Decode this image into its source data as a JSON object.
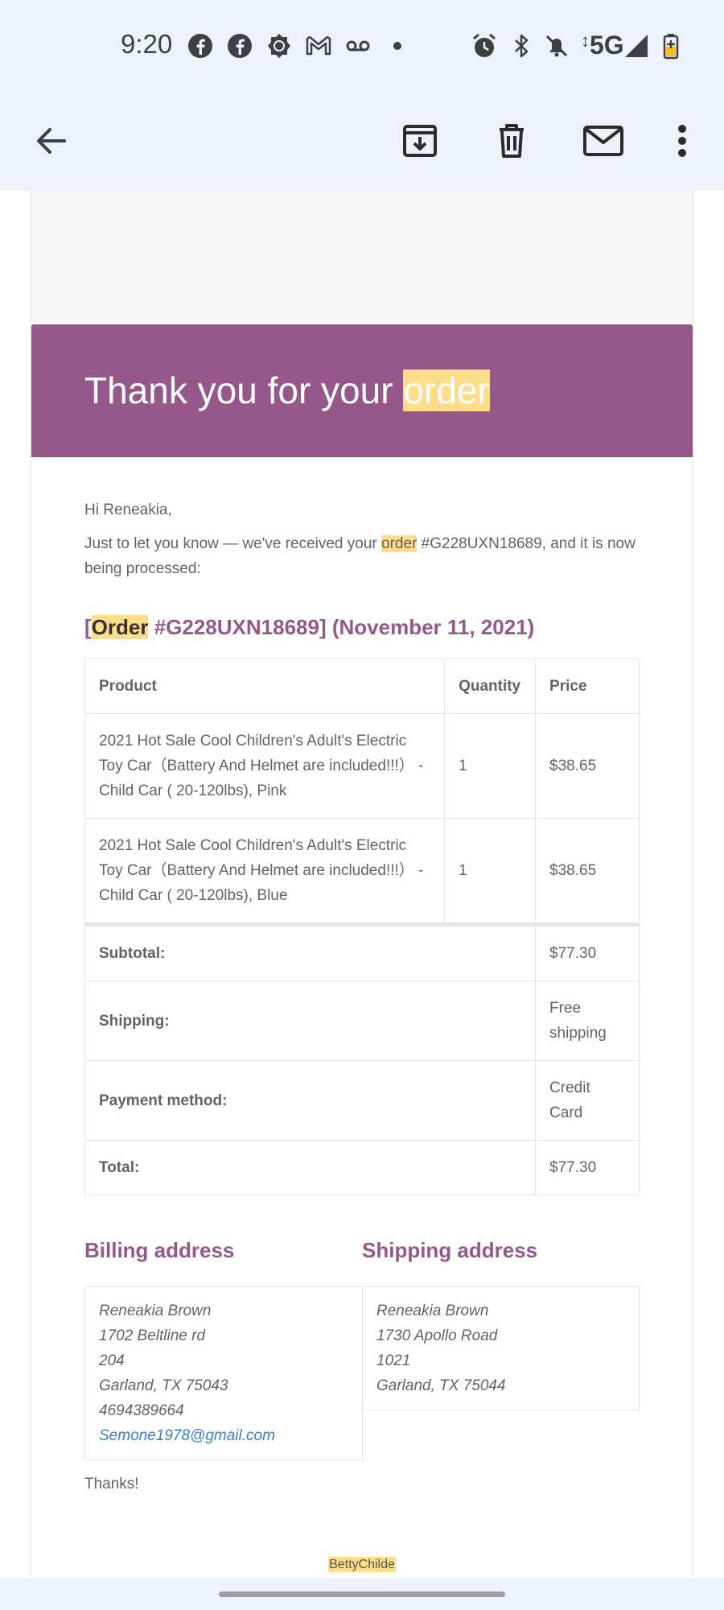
{
  "status_bar": {
    "time": "9:20",
    "network": "5G",
    "left_icons": [
      "facebook-icon",
      "facebook-icon",
      "settings-badge-icon",
      "gmail-icon",
      "voicemail-icon",
      "dot-icon"
    ],
    "right_icons": [
      "alarm-icon",
      "bluetooth-icon",
      "bell-off-icon",
      "signal-icon",
      "battery-icon"
    ]
  },
  "toolbar": {
    "icons": [
      "back-arrow-icon",
      "archive-icon",
      "delete-icon",
      "mark-unread-icon",
      "more-vert-icon"
    ]
  },
  "email": {
    "header": {
      "title_prefix": "Thank you for your ",
      "title_highlight": "order"
    },
    "greeting": "Hi Reneakia,",
    "intro_before": "Just to let you know — we've received your ",
    "intro_highlight": "order",
    "intro_after": " #G228UXN18689, and it is now being processed:",
    "order_heading": {
      "bracket_open": "[",
      "highlight": "Order",
      "rest": " #G228UXN18689] (November 11, 2021)"
    },
    "table": {
      "headers": [
        "Product",
        "Quantity",
        "Price"
      ],
      "items": [
        {
          "product": "2021 Hot Sale Cool Children's Adult's Electric Toy Car（Battery And Helmet are included!!!） - Child Car ( 20-120lbs), Pink",
          "quantity": "1",
          "price": "$38.65"
        },
        {
          "product": "2021 Hot Sale Cool Children's Adult's Electric Toy Car（Battery And Helmet are included!!!） - Child Car ( 20-120lbs), Blue",
          "quantity": "1",
          "price": "$38.65"
        }
      ],
      "totals": [
        {
          "label": "Subtotal:",
          "value": "$77.30"
        },
        {
          "label": "Shipping:",
          "value": "Free shipping"
        },
        {
          "label": "Payment method:",
          "value": "Credit Card"
        },
        {
          "label": "Total:",
          "value": "$77.30"
        }
      ]
    },
    "billing": {
      "heading": "Billing address",
      "lines": [
        "Reneakia Brown",
        "1702 Beltline rd",
        "204",
        "Garland, TX 75043",
        "4694389664"
      ],
      "email": "Semone1978@gmail.com"
    },
    "shipping": {
      "heading": "Shipping address",
      "lines": [
        "Reneakia Brown",
        "1730 Apollo Road",
        "1021",
        "Garland, TX 75044"
      ]
    },
    "thanks": "Thanks!",
    "footer_name": "BettyChilde"
  },
  "colors": {
    "brand": "#96588a",
    "highlight": "#fddd8a",
    "text": "#636363",
    "link": "#3a7dc9"
  }
}
